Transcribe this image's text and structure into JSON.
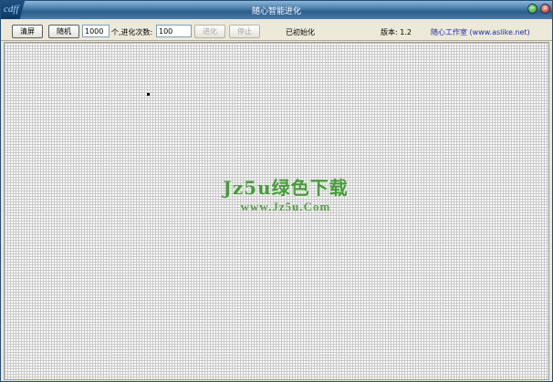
{
  "window": {
    "title": "随心智能进化",
    "logo_text": "cdff",
    "minimize_icon": "minimize-icon",
    "close_icon": "close-icon",
    "minimize_glyph": "−",
    "close_glyph": "×"
  },
  "toolbar": {
    "clear_label": "清屏",
    "random_label": "随机",
    "count_value": "1000",
    "count_unit": "个,进化次数:",
    "evolve_times_value": "100",
    "evolve_label": "进化",
    "stop_label": "停止",
    "status_text": "已初始化",
    "version_text": "版本: 1.2",
    "studio_link": "随心工作室 (www.aslike.net)"
  },
  "watermark": {
    "line1": "Jz5u绿色下载",
    "line2": "www.Jz5u.Com"
  },
  "colors": {
    "title_bar": "#2b5d8c",
    "grid_line": "#c8c8c8",
    "link": "#1c2fa8",
    "watermark": "#4a9a3c"
  }
}
